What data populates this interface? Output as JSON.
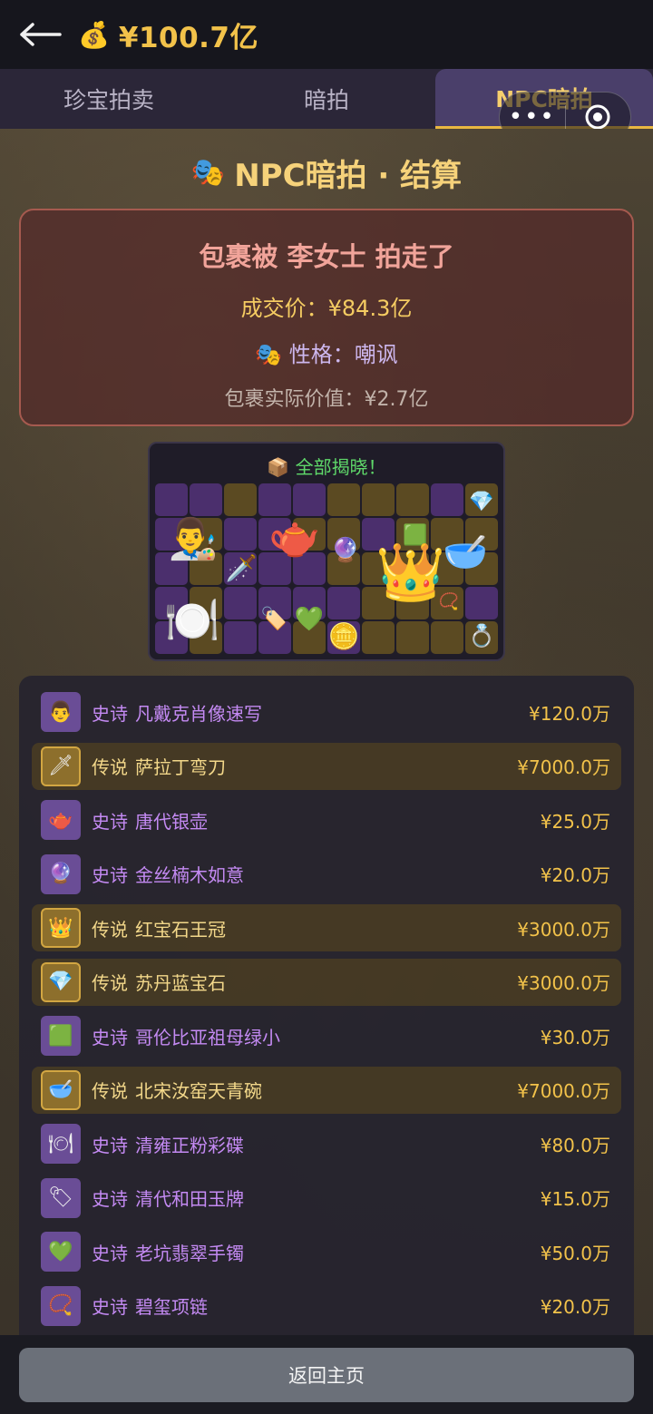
{
  "header": {
    "money_icon": "💰",
    "balance": "¥100.7亿"
  },
  "tabs": [
    "珍宝拍卖",
    "暗拍",
    "NPC暗拍"
  ],
  "active_tab": 2,
  "capsule": {
    "more": "•••"
  },
  "title": {
    "icon": "🎭",
    "text": "NPC暗拍 · 结算"
  },
  "result": {
    "headline": "包裹被 李女士 拍走了",
    "price": "成交价：¥84.3亿",
    "personality_icon": "🎭",
    "personality": "性格：嘲讽",
    "actual_value": "包裹实际价值：¥2.7亿"
  },
  "reveal": {
    "icon": "📦",
    "text": "全部揭晓！"
  },
  "items": [
    {
      "rarity": "史诗",
      "name": "凡戴克肖像速写",
      "value": "¥120.0万",
      "tier": "epic",
      "icon": "👨"
    },
    {
      "rarity": "传说",
      "name": "萨拉丁弯刀",
      "value": "¥7000.0万",
      "tier": "legend",
      "icon": "🗡"
    },
    {
      "rarity": "史诗",
      "name": "唐代银壶",
      "value": "¥25.0万",
      "tier": "epic",
      "icon": "🫖"
    },
    {
      "rarity": "史诗",
      "name": "金丝楠木如意",
      "value": "¥20.0万",
      "tier": "epic",
      "icon": "🔮"
    },
    {
      "rarity": "传说",
      "name": "红宝石王冠",
      "value": "¥3000.0万",
      "tier": "legend",
      "icon": "👑"
    },
    {
      "rarity": "传说",
      "name": "苏丹蓝宝石",
      "value": "¥3000.0万",
      "tier": "legend",
      "icon": "💎"
    },
    {
      "rarity": "史诗",
      "name": "哥伦比亚祖母绿小",
      "value": "¥30.0万",
      "tier": "epic",
      "icon": "🟩"
    },
    {
      "rarity": "传说",
      "name": "北宋汝窑天青碗",
      "value": "¥7000.0万",
      "tier": "legend",
      "icon": "🥣"
    },
    {
      "rarity": "史诗",
      "name": "清雍正粉彩碟",
      "value": "¥80.0万",
      "tier": "epic",
      "icon": "🍽"
    },
    {
      "rarity": "史诗",
      "name": "清代和田玉牌",
      "value": "¥15.0万",
      "tier": "epic",
      "icon": "🏷"
    },
    {
      "rarity": "史诗",
      "name": "老坑翡翠手镯",
      "value": "¥50.0万",
      "tier": "epic",
      "icon": "💚"
    },
    {
      "rarity": "史诗",
      "name": "碧玺项链",
      "value": "¥20.0万",
      "tier": "epic",
      "icon": "📿"
    }
  ],
  "bottom": {
    "home_label": "返回主页"
  },
  "colors": {
    "gold": "#f2c24a",
    "epic": "#c48af3",
    "legend": "#f3d88a",
    "active_tab": "#4a3f6a"
  }
}
